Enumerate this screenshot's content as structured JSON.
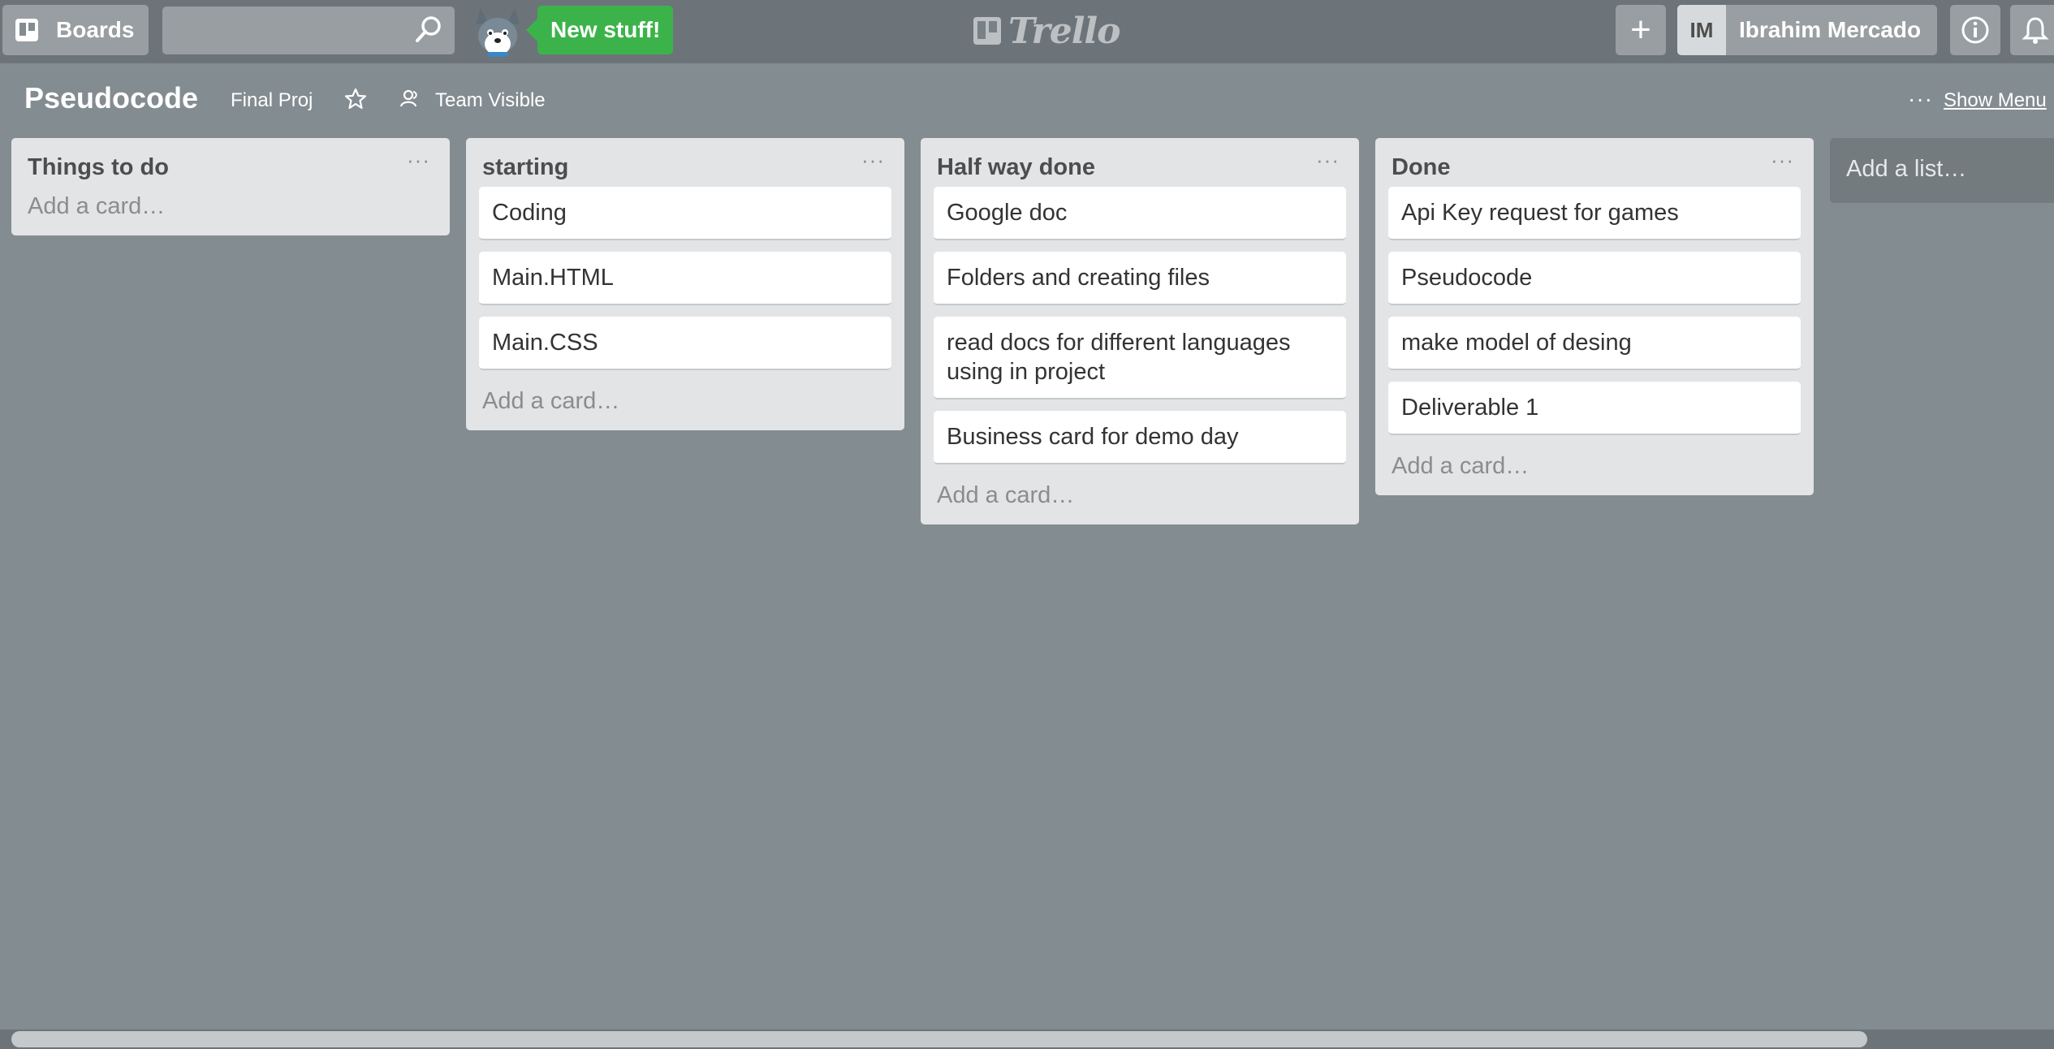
{
  "header": {
    "boards_label": "Boards",
    "search_placeholder": "",
    "new_stuff_label": "New stuff!",
    "logo_text": "Trello",
    "add_label": "+",
    "user_initials": "IM",
    "user_name": "Ibrahim Mercado"
  },
  "board": {
    "title": "Pseudocode",
    "team": "Final Proj",
    "visibility": "Team Visible",
    "menu_dots": "···",
    "show_menu": "Show Menu"
  },
  "lists": [
    {
      "title": "Things to do",
      "menu": "···",
      "cards": [],
      "add_card": "Add a card…"
    },
    {
      "title": "starting",
      "menu": "···",
      "cards": [
        "Coding",
        "Main.HTML",
        "Main.CSS"
      ],
      "add_card": "Add a card…"
    },
    {
      "title": "Half way done",
      "menu": "···",
      "cards": [
        "Google doc",
        "Folders and creating files",
        "read docs for different languages using in project",
        "Business card for demo day"
      ],
      "add_card": "Add a card…"
    },
    {
      "title": "Done",
      "menu": "···",
      "cards": [
        "Api Key request for games",
        "Pseudocode",
        "make model of desing",
        "Deliverable 1"
      ],
      "add_card": "Add a card…"
    }
  ],
  "add_list": "Add a list…",
  "colors": {
    "background": "#838c91",
    "topbar": "#6c7479",
    "new_stuff": "#3cb34a",
    "list_bg": "#e2e4e6"
  }
}
